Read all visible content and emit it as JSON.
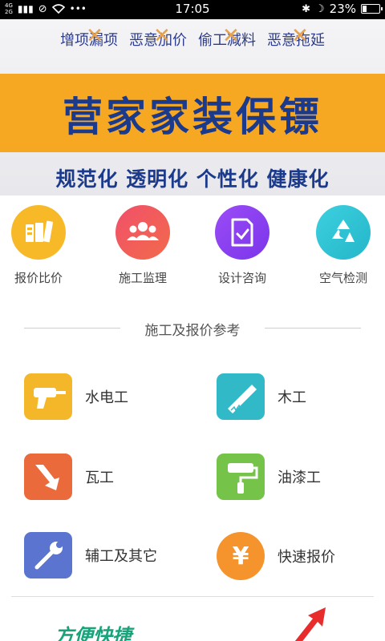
{
  "status_bar": {
    "network_top": "4G",
    "network_bottom": "2G",
    "dots": "•••",
    "time": "17:05",
    "battery": "23%",
    "battery_level": 0.23
  },
  "banner": {
    "terms": [
      "增项漏项",
      "恶意加价",
      "偷工减料",
      "恶意拖延"
    ],
    "brand": "营家家装保镖",
    "slogan": "规范化 透明化 个性化 健康化",
    "colors": {
      "band": "#f7a823",
      "brand_text": "#1c3a8c"
    }
  },
  "services": [
    {
      "label": "报价比价",
      "icon": "calculator-icon",
      "color": "#f7b928"
    },
    {
      "label": "施工监理",
      "icon": "people-icon",
      "color": "#ef4d64"
    },
    {
      "label": "设计咨询",
      "icon": "document-check-icon",
      "color": "#8a3ff2"
    },
    {
      "label": "空气检测",
      "icon": "recycle-icon",
      "color": "#34c7d8"
    }
  ],
  "section_title": "施工及报价参考",
  "categories": [
    {
      "label": "水电工",
      "icon": "drill-icon",
      "color": "#f5b72a"
    },
    {
      "label": "木工",
      "icon": "saw-icon",
      "color": "#32b9c8"
    },
    {
      "label": "瓦工",
      "icon": "trowel-icon",
      "color": "#ea6a3c"
    },
    {
      "label": "油漆工",
      "icon": "paint-roller-icon",
      "color": "#76c34a"
    },
    {
      "label": "辅工及其它",
      "icon": "wrench-icon",
      "color": "#5a74d0"
    },
    {
      "label": "快速报价",
      "icon": "yen-icon",
      "color": "#f5932c"
    }
  ],
  "promo": {
    "text": "方便快捷"
  }
}
